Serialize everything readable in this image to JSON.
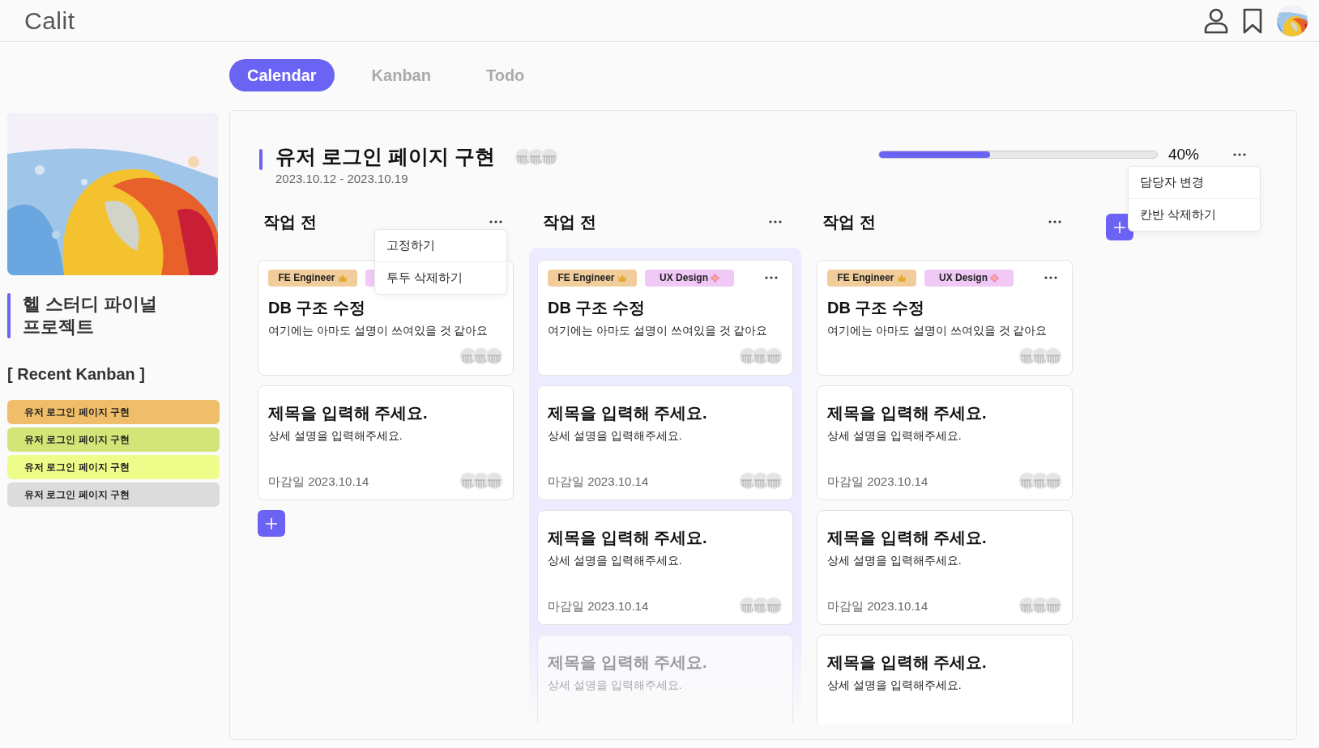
{
  "app": {
    "logo": "Calit"
  },
  "tabs": [
    {
      "label": "Calendar",
      "selected": true
    },
    {
      "label": "Kanban",
      "selected": false
    },
    {
      "label": "Todo",
      "selected": false
    }
  ],
  "sidebar": {
    "project_title": "헬 스터디 파이널 프로젝트",
    "recent_heading": "[ Recent Kanban ]",
    "recent_items": [
      {
        "label": "유저 로그인 페이지 구현",
        "color": "#f0be6a"
      },
      {
        "label": "유저 로그인 페이지 구현",
        "color": "#d3e577"
      },
      {
        "label": "유저 로그인 페이지 구현",
        "color": "#eefd8a"
      },
      {
        "label": "유저 로그인 페이지 구현",
        "color": "#dcdcdc"
      }
    ]
  },
  "board": {
    "title": "유저 로그인 페이지 구현",
    "dates": "2023.10.12 - 2023.10.19",
    "progress": {
      "level": 0.4,
      "reading": "40%"
    },
    "menu": {
      "items": [
        "담당자 변경",
        "칸반 삭제하기"
      ]
    },
    "columns": [
      {
        "title": "작업 전",
        "highlighted": false,
        "add_button": true,
        "menu": {
          "items": [
            "고정하기",
            "투두 삭제하기"
          ]
        },
        "cards": [
          {
            "kind": "tagged",
            "tags": [
              {
                "label": "FE Engineer",
                "color": "#f2cd9c"
              },
              {
                "color": "#f1c9f6"
              }
            ],
            "title": "DB 구조 수정",
            "description": "여기에는 아마도 설명이 쓰여있을 것 같아요"
          },
          {
            "kind": "basic",
            "title": "제목을 입력해 주세요.",
            "description": "상세 설명을 입력해주세요.",
            "due": "마감일 2023.10.14",
            "faded": false
          }
        ]
      },
      {
        "title": "작업 전",
        "highlighted": true,
        "add_button": false,
        "cards": [
          {
            "kind": "tagged",
            "tags": [
              {
                "label": "FE Engineer",
                "color": "#f2cd9c"
              },
              {
                "label": "UX Design",
                "color": "#f1c9f6"
              }
            ],
            "menu_button": true,
            "title": "DB 구조 수정",
            "description": "여기에는 아마도 설명이 쓰여있을 것 같아요"
          },
          {
            "kind": "basic",
            "title": "제목을 입력해 주세요.",
            "description": "상세 설명을 입력해주세요.",
            "due": "마감일 2023.10.14",
            "faded": false
          },
          {
            "kind": "basic",
            "title": "제목을 입력해 주세요.",
            "description": "상세 설명을 입력해주세요.",
            "due": "마감일 2023.10.14",
            "faded": false
          },
          {
            "kind": "basic",
            "title": "제목을 입력해 주세요.",
            "description": "상세 설명을 입력해주세요.",
            "faded": true
          }
        ]
      },
      {
        "title": "작업 전",
        "highlighted": false,
        "add_button": false,
        "cards": [
          {
            "kind": "tagged",
            "tags": [
              {
                "label": "FE Engineer",
                "color": "#f2cd9c"
              },
              {
                "label": "UX Design",
                "color": "#f1c9f6"
              }
            ],
            "menu_button": true,
            "title": "DB 구조 수정",
            "description": "여기에는 아마도 설명이 쓰여있을 것 같아요"
          },
          {
            "kind": "basic",
            "title": "제목을 입력해 주세요.",
            "description": "상세 설명을 입력해주세요.",
            "due": "마감일 2023.10.14",
            "faded": false
          },
          {
            "kind": "basic",
            "title": "제목을 입력해 주세요.",
            "description": "상세 설명을 입력해주세요.",
            "due": "마감일 2023.10.14",
            "faded": false
          },
          {
            "kind": "basic",
            "title": "제목을 입력해 주세요.",
            "description": "상세 설명을 입력해주세요.",
            "faded": false
          }
        ]
      }
    ]
  }
}
